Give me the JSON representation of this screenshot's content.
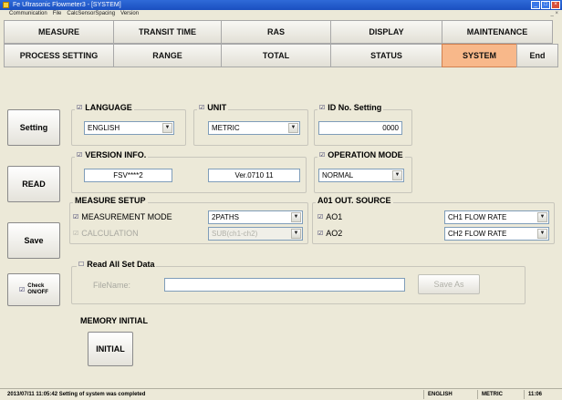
{
  "window": {
    "title": "Fe Ultrasonic Flowmeter3 - [SYSTEM]"
  },
  "menu": {
    "items": [
      "Communication",
      "File",
      "CalcSensorSpacing",
      "Version"
    ],
    "mdi_controls": "_ ×"
  },
  "tabs": {
    "row1": [
      "MEASURE",
      "TRANSIT TIME",
      "RAS",
      "DISPLAY",
      "MAINTENANCE"
    ],
    "row2": [
      "PROCESS SETTING",
      "RANGE",
      "TOTAL",
      "STATUS",
      "SYSTEM",
      "End"
    ],
    "active": "SYSTEM"
  },
  "side_buttons": {
    "setting": "Setting",
    "read": "READ",
    "save": "Save",
    "check_line1": "Check",
    "check_line2": "ON/OFF"
  },
  "language": {
    "label": "LANGUAGE",
    "value": "ENGLISH"
  },
  "unit": {
    "label": "UNIT",
    "value": "METRIC"
  },
  "id_setting": {
    "label": "ID No. Setting",
    "value": "0000"
  },
  "version_info": {
    "label": "VERSION INFO.",
    "firmware": "FSV****2",
    "version": "Ver.0710   11"
  },
  "operation_mode": {
    "label": "OPERATION MODE",
    "value": "NORMAL"
  },
  "measure_setup": {
    "label": "MEASURE SETUP",
    "measurement_mode_label": "MEASUREMENT MODE",
    "measurement_mode_value": "2PATHS",
    "calculation_label": "CALCULATION",
    "calculation_value": "SUB(ch1-ch2)"
  },
  "ao_out_source": {
    "label": "A01 OUT. SOURCE",
    "ao1_label": "AO1",
    "ao1_value": "CH1 FLOW RATE",
    "ao2_label": "AO2",
    "ao2_value": "CH2 FLOW RATE"
  },
  "read_all": {
    "label": "Read All Set Data",
    "filename_label": "FileName:",
    "filename_value": "",
    "save_as": "Save As"
  },
  "memory_initial": {
    "label": "MEMORY INITIAL",
    "button": "INITIAL"
  },
  "status": {
    "message": "2013/07/11 11:05:42 Setting of system was completed",
    "language": "ENGLISH",
    "unit": "METRIC",
    "time": "11:06"
  },
  "colors": {
    "active_tab": "#f8b88a",
    "titlebar": "#1a4fc0",
    "background": "#ece9d8"
  }
}
